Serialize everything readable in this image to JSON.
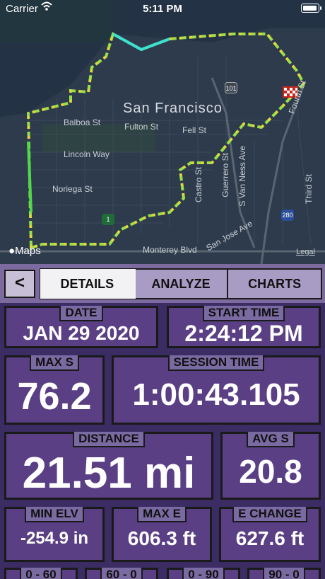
{
  "status_bar": {
    "carrier": "Carrier",
    "time": "5:11 PM"
  },
  "map": {
    "city": "San Francisco",
    "labels": [
      "Balboa St",
      "Fulton St",
      "Fell St",
      "Lincoln Way",
      "Noriega St",
      "Castro St",
      "Guerrero St",
      "S Van Ness Ave",
      "Third St",
      "Monterey Blvd",
      "San Jose Ave",
      "Fourth St"
    ],
    "highways": [
      "101",
      "1",
      "280"
    ],
    "maps_logo": "Maps",
    "legal": "Legal"
  },
  "tabs": {
    "back": "<",
    "items": [
      "DETAILS",
      "ANALYZE",
      "CHARTS"
    ],
    "active": "DETAILS"
  },
  "stats": {
    "date": {
      "label": "DATE",
      "value": "JAN 29 2020"
    },
    "start_time": {
      "label": "START TIME",
      "value": "2:24:12 PM"
    },
    "max_s": {
      "label": "MAX S",
      "value": "76.2"
    },
    "session_time": {
      "label": "SESSION TIME",
      "value": "1:00:43.105"
    },
    "distance": {
      "label": "DISTANCE",
      "value": "21.51 mi"
    },
    "avg_s": {
      "label": "AVG S",
      "value": "20.8"
    },
    "min_elv": {
      "label": "MIN ELV",
      "value": "-254.9 in"
    },
    "max_e": {
      "label": "MAX E",
      "value": "606.3 ft"
    },
    "e_change": {
      "label": "E CHANGE",
      "value": "627.6 ft"
    },
    "bottom_labels": [
      "0 - 60",
      "60 - 0",
      "0 - 90",
      "90 - 0"
    ]
  }
}
